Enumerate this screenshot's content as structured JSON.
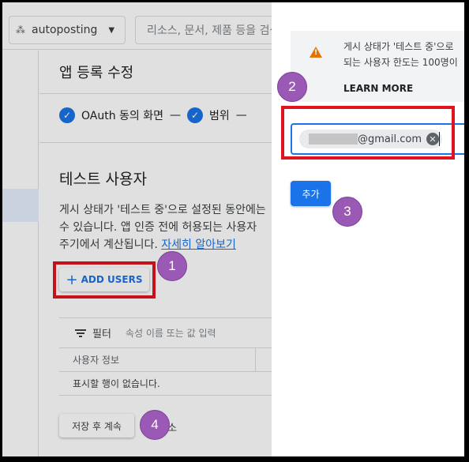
{
  "header": {
    "project_name": "autoposting",
    "search_placeholder": "리소스, 문서, 제품 등을 검색"
  },
  "main": {
    "page_title": "앱 등록 수정",
    "steps": [
      {
        "label": "OAuth 동의 화면",
        "sep": "—"
      },
      {
        "label": "범위",
        "sep": "—"
      }
    ],
    "section_title": "테스트 사용자",
    "desc_line1": "게시 상태가 '테스트 중'으로 설정된 동안에는",
    "desc_line2": "수 있습니다. 앱 인증 전에 허용되는 사용자",
    "desc_line3": "주기에서 계산됩니다.",
    "desc_link": "자세히 알아보기",
    "add_users_label": "ADD USERS",
    "filter_label": "필터",
    "filter_placeholder": "속성 이름 또는 값 입력",
    "col_user_info": "사용자 정보",
    "empty_text": "표시할 행이 없습니다.",
    "save_label": "저장 후 계속",
    "save_suffix": "소"
  },
  "panel": {
    "notice_line1": "게시 상태가 '테스트 중'으로",
    "notice_line2": "되는 사용자 한도는 100명이",
    "learn_more": "LEARN MORE",
    "email_suffix": "@gmail.com",
    "add_button": "추가"
  },
  "badges": [
    "1",
    "2",
    "3",
    "4"
  ],
  "colors": {
    "accent": "#1a73e8",
    "highlight_box": "#e0141e",
    "badge": "#9b59b6",
    "warning": "#e37400"
  }
}
